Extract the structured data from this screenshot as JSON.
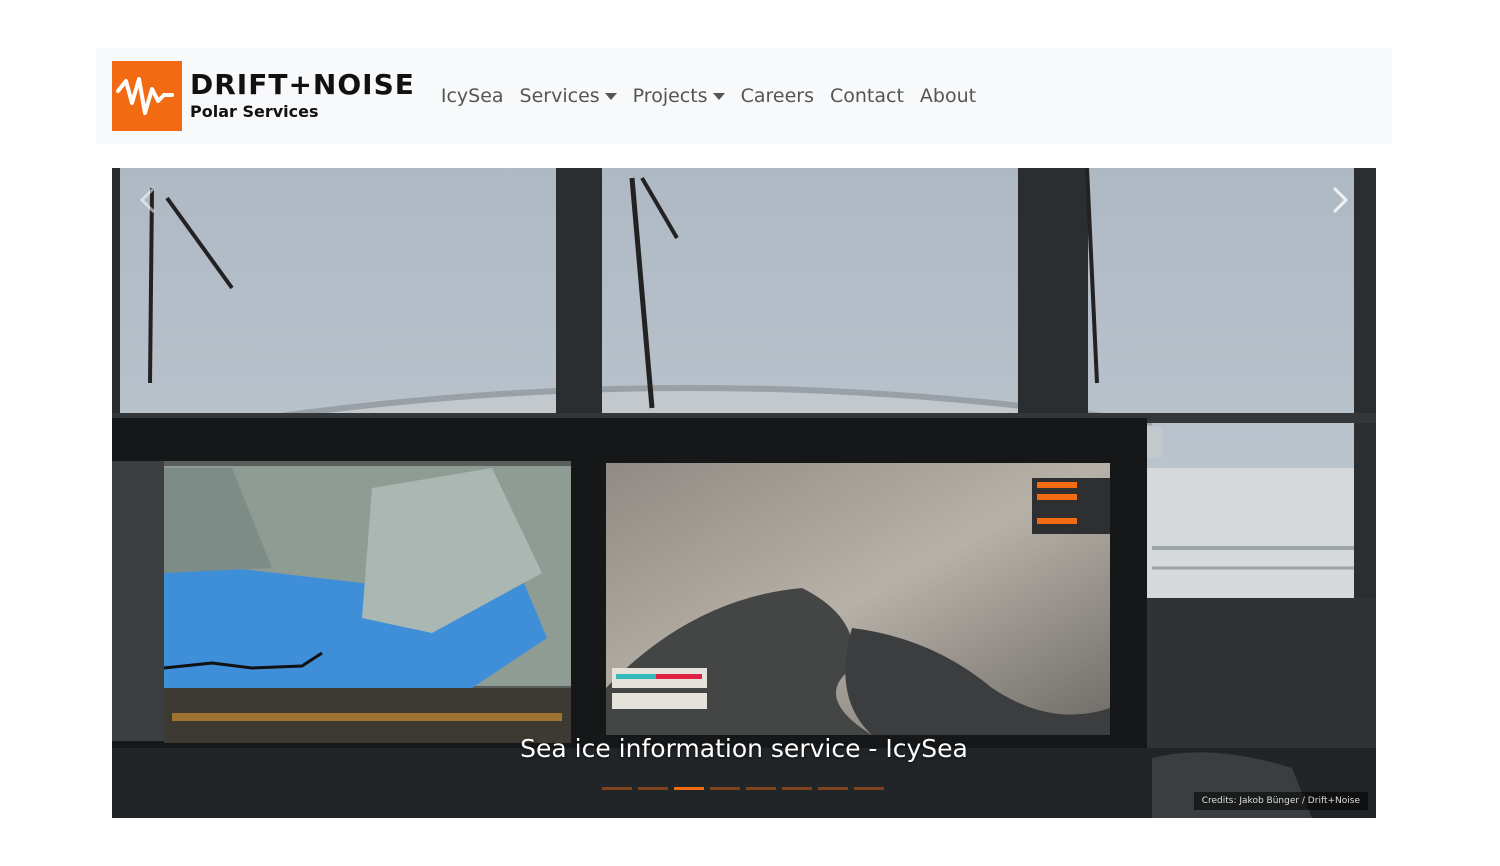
{
  "brand": {
    "title": "DRIFT+NOISE",
    "subtitle": "Polar Services",
    "accent_color": "#f26a12",
    "icon": "waveform-logo-icon"
  },
  "nav": {
    "items": [
      {
        "label": "IcySea",
        "dropdown": false
      },
      {
        "label": "Services",
        "dropdown": true
      },
      {
        "label": "Projects",
        "dropdown": true
      },
      {
        "label": "Careers",
        "dropdown": false
      },
      {
        "label": "Contact",
        "dropdown": false
      },
      {
        "label": "About",
        "dropdown": false
      }
    ]
  },
  "carousel": {
    "caption": "Sea ice information service - IcySea",
    "credits": "Credits: Jakob Bünger / Drift+Noise",
    "slide_count": 8,
    "active_index": 2,
    "prev_icon": "chevron-left-icon",
    "next_icon": "chevron-right-icon"
  }
}
